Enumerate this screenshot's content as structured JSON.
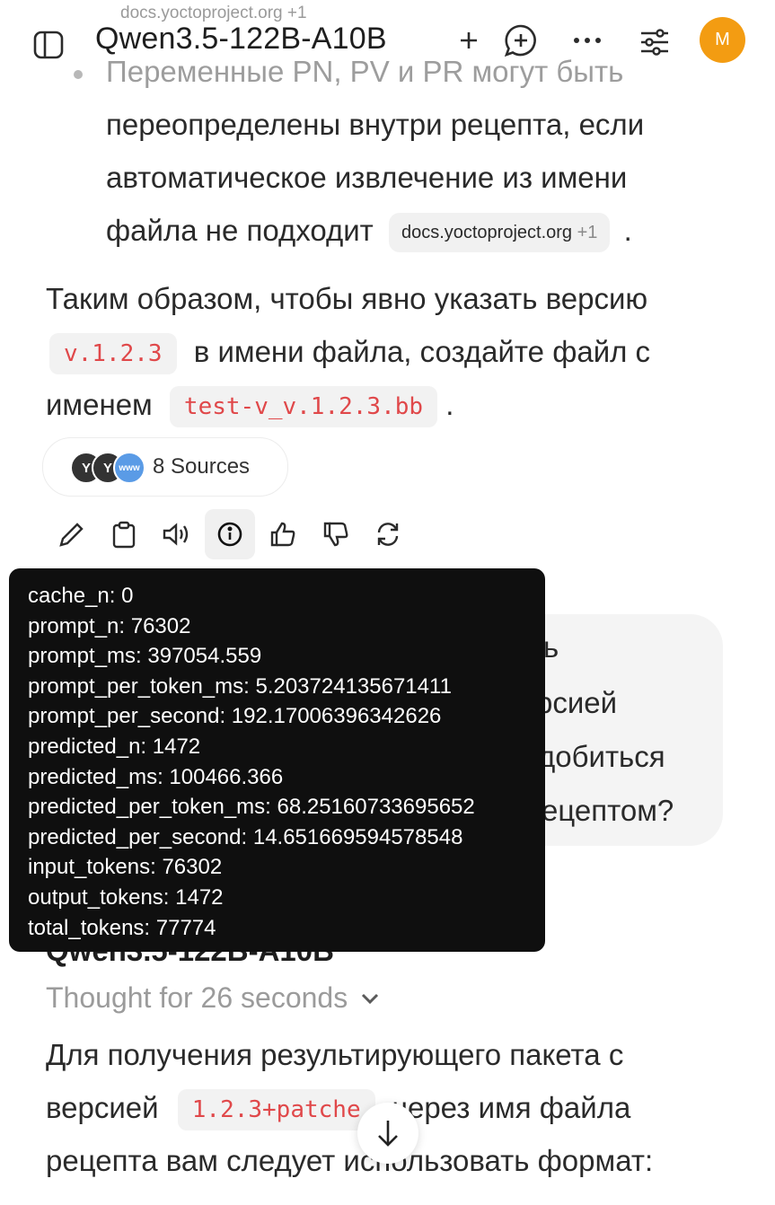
{
  "header": {
    "ghost_source": "docs.yoctoproject.org +1",
    "model": "Qwen3.5-122B-A10B",
    "avatar_initial": "M",
    "avatar_color": "#f39c12"
  },
  "answer": {
    "bullet": {
      "line1": "Переменные PN, PV и PR могут быть",
      "line2": "переопределены внутри рецепта, если",
      "line3": "автоматическое извлечение из имени",
      "line4": "файла не подходит",
      "chip_source": "docs.yoctoproject.org",
      "chip_plus": "+1",
      "end": "."
    },
    "para": {
      "line1": "Таким образом, чтобы явно указать версию",
      "code1": "v.1.2.3",
      "line2_rest": "в имени файла, создайте файл с",
      "line3_pre": "именем",
      "code2": "test-v_v.1.2.3.bb",
      "line3_end": "."
    }
  },
  "sources": {
    "label": "8 Sources",
    "icons": [
      "yocto-icon",
      "yocto-icon",
      "www-icon"
    ]
  },
  "actions": [
    "edit-icon",
    "copy-icon",
    "speaker-icon",
    "info-icon",
    "thumbs-up-icon",
    "thumbs-down-icon",
    "regenerate-icon"
  ],
  "tooltip": {
    "rows": [
      "cache_n: 0",
      "prompt_n: 76302",
      "prompt_ms: 397054.559",
      "prompt_per_token_ms: 5.203724135671411",
      "prompt_per_second: 192.17006396342626",
      "predicted_n: 1472",
      "predicted_ms: 100466.366",
      "predicted_per_token_ms: 68.25160733695652",
      "predicted_per_second: 14.651669594578548",
      "input_tokens: 76302",
      "output_tokens: 1472",
      "total_tokens: 77774"
    ]
  },
  "user_bubble": {
    "line1": "ь",
    "line2": "рсией",
    "line3": "добиться",
    "line4": "ецептом?"
  },
  "second_reply": {
    "model": "Qwen3.5-122B-A10B",
    "thought": "Thought for 26 seconds",
    "line1": "Для получения результирующего пакета с",
    "line2_pre": "версией",
    "code": "1.2.3+patche",
    "line2_post": "через имя файла",
    "line3": "рецепта вам следует использовать формат:"
  }
}
